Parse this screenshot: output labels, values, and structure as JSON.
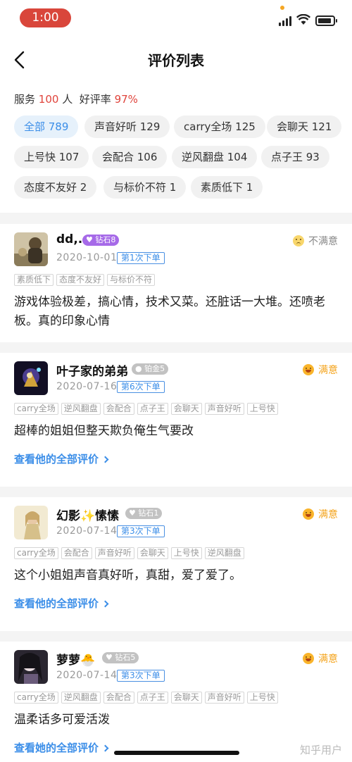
{
  "status_bar": {
    "time": "1:00"
  },
  "nav": {
    "title": "评价列表"
  },
  "summary": {
    "service_label": "服务",
    "service_count": "100",
    "service_unit": "人",
    "rate_label": "好评率",
    "rate_value": "97%"
  },
  "filters": [
    {
      "label": "全部 789",
      "active": true
    },
    {
      "label": "声音好听 129"
    },
    {
      "label": "carry全场 125"
    },
    {
      "label": "会聊天 121"
    },
    {
      "label": "上号快 107"
    },
    {
      "label": "会配合 106"
    },
    {
      "label": "逆风翻盘 104"
    },
    {
      "label": "点子王 93"
    },
    {
      "label": "态度不友好 2"
    },
    {
      "label": "与标价不符 1"
    },
    {
      "label": "素质低下 1"
    }
  ],
  "reviews": [
    {
      "username": "dd,.",
      "level": "钻石8",
      "date": "2020-10-01",
      "order": "第1次下单",
      "rating": "不满意",
      "tags": [
        "素质低下",
        "态度不友好",
        "与标价不符"
      ],
      "comment": "游戏体验极差，搞心情，技术又菜。还脏话一大堆。还喷老板。真的印象心情",
      "view_all": ""
    },
    {
      "username": "叶子家的弟弟",
      "level": "铂金5",
      "date": "2020-07-16",
      "order": "第6次下单",
      "rating": "满意",
      "tags": [
        "carry全场",
        "逆风翻盘",
        "会配合",
        "点子王",
        "会聊天",
        "声音好听",
        "上号快"
      ],
      "comment": "超棒的姐姐但整天欺负俺生气要改",
      "view_all": "查看他的全部评价"
    },
    {
      "username": "幻影✨愫愫",
      "level": "钻石1",
      "date": "2020-07-14",
      "order": "第3次下单",
      "rating": "满意",
      "tags": [
        "carry全场",
        "会配合",
        "声音好听",
        "会聊天",
        "上号快",
        "逆风翻盘"
      ],
      "comment": "这个小姐姐声音真好听，真甜，爱了爱了。",
      "view_all": "查看他的全部评价"
    },
    {
      "username": "萝萝🐣",
      "level": "钻石5",
      "date": "2020-07-14",
      "order": "第3次下单",
      "rating": "满意",
      "tags": [
        "carry全场",
        "逆风翻盘",
        "会配合",
        "点子王",
        "会聊天",
        "声音好听",
        "上号快"
      ],
      "comment": "温柔话多可爱活泼",
      "view_all": "查看她的全部评价"
    }
  ],
  "watermark": "知乎用户",
  "colors": {
    "accent": "#3b8ee8",
    "red": "#e0443c",
    "good": "#f4a41d"
  }
}
